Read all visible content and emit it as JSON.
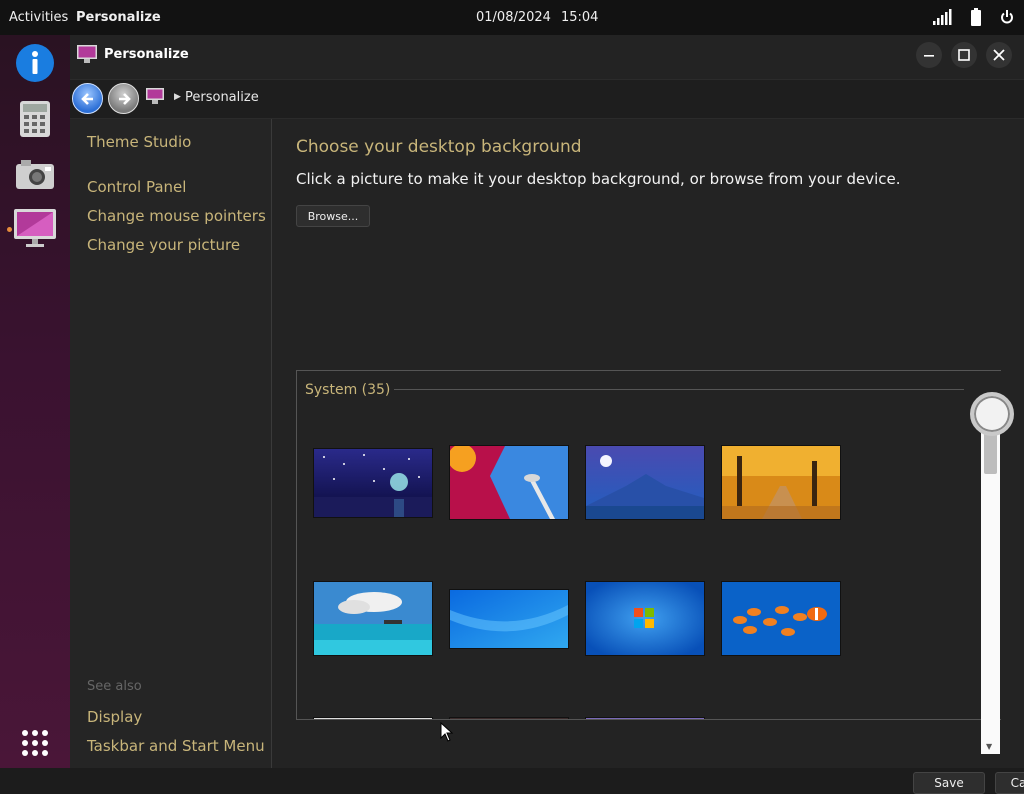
{
  "topbar": {
    "activities": "Activities",
    "app_name": "Personalize",
    "date": "01/08/2024",
    "time": "15:04",
    "tray_icons": [
      "signal-icon",
      "battery-icon",
      "power-icon"
    ]
  },
  "dock": {
    "items": [
      "info-icon",
      "calculator-icon",
      "camera-icon",
      "personalize-icon"
    ],
    "apps_grid": "apps-grid-icon"
  },
  "window": {
    "title": "Personalize",
    "breadcrumb": "Personalize",
    "sidebar": {
      "top_links": [
        "Theme Studio",
        "Control Panel",
        "Change mouse pointers",
        "Change your picture"
      ],
      "see_also_label": "See also",
      "see_also_links": [
        "Display",
        "Taskbar and Start Menu"
      ]
    },
    "main": {
      "heading": "Choose your desktop background",
      "subheading": "Click a picture to make it your desktop background, or browse from your device.",
      "browse_label": "Browse...",
      "group_label": "System (35)",
      "wallpapers": [
        "night-lake-wallpaper",
        "space-needle-wallpaper",
        "moon-mountain-wallpaper",
        "autumn-road-wallpaper",
        "tropical-beach-wallpaper",
        "blue-wave-wallpaper",
        "windows-logo-wallpaper",
        "goldfish-wallpaper"
      ]
    },
    "footer": {
      "save_label": "Save",
      "cancel_label": "Cancel"
    }
  }
}
